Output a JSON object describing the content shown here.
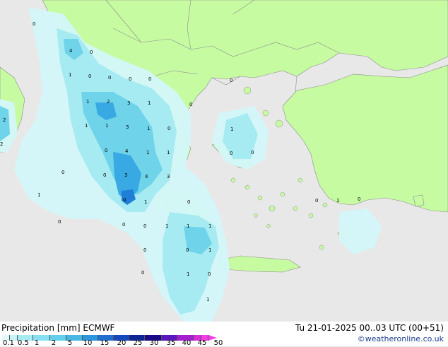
{
  "map": {
    "colors": {
      "sea": "#e8e8e8",
      "land": "#c6fba2",
      "border": "#8c8c8c",
      "p_light": "#d4f7f9",
      "p_mid": "#a6ebf2",
      "p_strong": "#6fd3ea",
      "p_heavy": "#38a9e3",
      "p_max": "#1f7fd6"
    },
    "values": [
      "4",
      "0",
      "1",
      "0",
      "0",
      "0",
      "0",
      "0",
      "1",
      "2",
      "3",
      "1",
      "0",
      "1",
      "1",
      "0",
      "3",
      "1",
      "0",
      "1",
      "0",
      "4",
      "1",
      "1",
      "0",
      "0",
      "0",
      "1",
      "0",
      "3",
      "4",
      "3",
      "1",
      "0",
      "0",
      "1",
      "0",
      "0",
      "0",
      "1",
      "1",
      "1",
      "0",
      "0",
      "1",
      "0",
      "1",
      "0",
      "0",
      "1",
      "0",
      "2",
      "2",
      "0",
      "0",
      "0",
      "0",
      "0",
      "0",
      "0"
    ]
  },
  "footer": {
    "title": "Precipitation [mm] ECMWF",
    "datetime": "Tu 21-01-2025 00..03 UTC (00+51)",
    "credit": "©weatheronline.co.uk"
  },
  "legend": {
    "ticks": [
      "0.1",
      "0.5",
      "1",
      "2",
      "5",
      "10",
      "15",
      "20",
      "25",
      "30",
      "35",
      "40",
      "45",
      "50"
    ],
    "colors": [
      "#e4f9fb",
      "#c8f2f7",
      "#a6ebf2",
      "#86e0f0",
      "#63cfe8",
      "#45b7e4",
      "#2c97dd",
      "#1e6fd0",
      "#1548bd",
      "#0d2696",
      "#1a0a8a",
      "#5b16bd",
      "#a41fcf",
      "#d82bd9",
      "#f53ee8"
    ]
  }
}
